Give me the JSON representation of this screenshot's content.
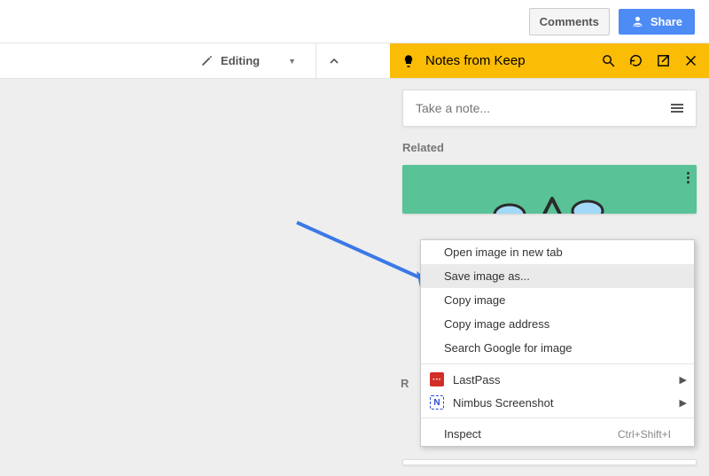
{
  "toolbar": {
    "comments": "Comments",
    "share": "Share",
    "editing": "Editing"
  },
  "keep": {
    "title": "Notes from Keep",
    "note_placeholder": "Take a note...",
    "related": "Related",
    "r_label": "R"
  },
  "context_menu": {
    "open_tab": "Open image in new tab",
    "save_as": "Save image as...",
    "copy_image": "Copy image",
    "copy_address": "Copy image address",
    "search_google": "Search Google for image",
    "lastpass": "LastPass",
    "nimbus": "Nimbus Screenshot",
    "inspect": "Inspect",
    "inspect_shortcut": "Ctrl+Shift+I"
  }
}
